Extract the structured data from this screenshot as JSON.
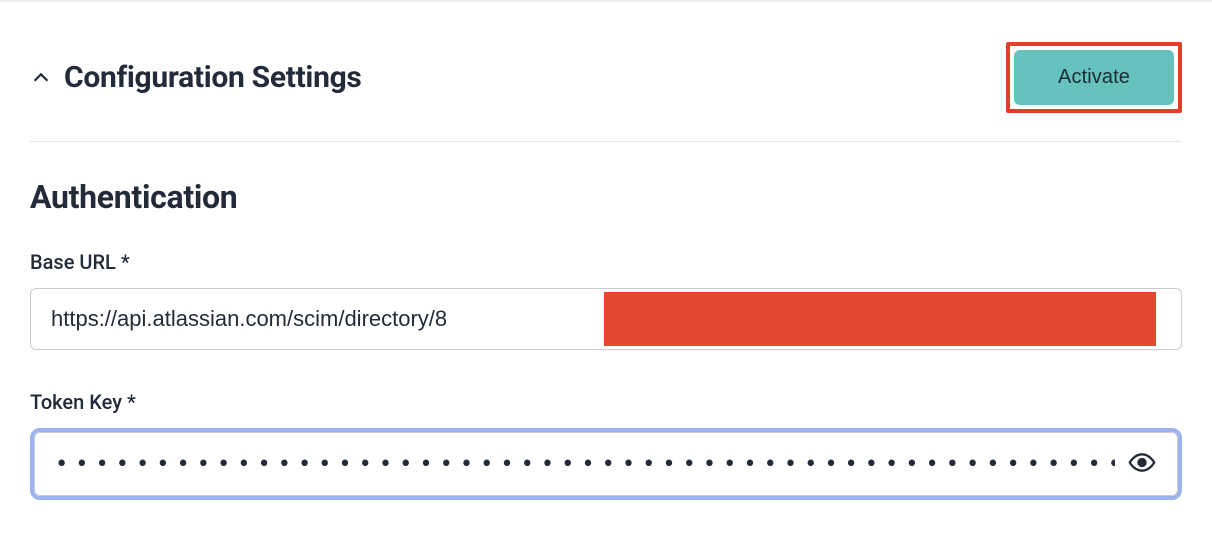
{
  "header": {
    "title": "Configuration Settings",
    "activate_label": "Activate"
  },
  "auth": {
    "section_title": "Authentication",
    "base_url_label": "Base URL *",
    "base_url_value": "https://api.atlassian.com/scim/directory/8                                                                                                 5",
    "token_key_label": "Token Key *",
    "token_key_value": "•••••••••••••••••••••••••••••••••••••••••••••••••••••••••••••••••••••••••••••••••••••••••"
  }
}
